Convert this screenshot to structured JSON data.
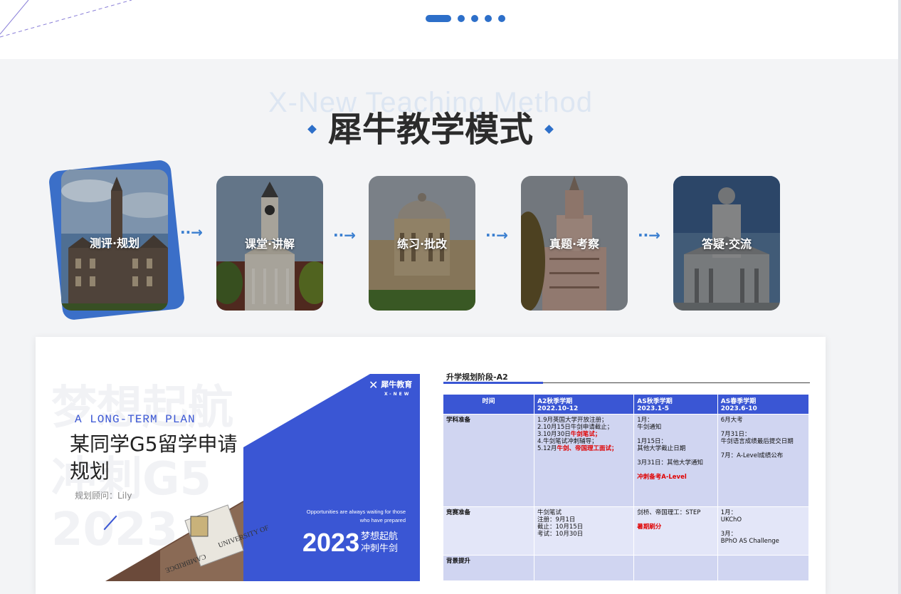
{
  "carousel": {
    "slide_count": 5,
    "active_index": 0
  },
  "section": {
    "title_en": "X-New Teaching Method",
    "title_zh": "犀牛教学模式"
  },
  "steps": [
    {
      "label": "测评·规划",
      "active": true
    },
    {
      "label": "课堂·讲解",
      "active": false
    },
    {
      "label": "练习·批改",
      "active": false
    },
    {
      "label": "真题·考察",
      "active": false
    },
    {
      "label": "答疑·交流",
      "active": false
    }
  ],
  "arrow_glyph": "··→",
  "plan_card": {
    "ghost_top": "梦想起航",
    "ghost_mid": "冲刺G5",
    "ghost_bottom": "2023",
    "subtitle_en": "A LONG-TERM PLAN",
    "title": "某同学G5留学申请规划",
    "advisor": "规划顾问：Lily",
    "logo_name": "犀牛教育",
    "logo_sub": "X-NEW",
    "tagline": "Opportunities are always waiting for those who have prepared",
    "year": "2023",
    "year_caption_1": "梦想起航",
    "year_caption_2": "冲刺牛剑",
    "crest_text_1": "UNIVERSITY OF",
    "crest_text_2": "CAMBRIDGE"
  },
  "plan_table": {
    "title": "升学规划阶段-A2",
    "headers": {
      "time": "时间",
      "col1_a": "A2秋季学期",
      "col1_b": "2022.10-12",
      "col2_a": "AS秋季学期",
      "col2_b": "2023.1-5",
      "col3_a": "AS春季学期",
      "col3_b": "2023.6-10"
    },
    "rows": {
      "r1_head": "学科准备",
      "r1_c1_l1": "1.9月英国大学开放注册；",
      "r1_c1_l2": "2.10月15日牛剑申请截止；",
      "r1_c1_l3a": "3.10月30日",
      "r1_c1_l3b": "牛剑笔试；",
      "r1_c1_l4": "4.牛剑笔试冲刺辅导；",
      "r1_c1_l5a": "5.12月",
      "r1_c1_l5b": "牛剑、帝国理工面试；",
      "r1_c2_l1": "1月：",
      "r1_c2_l2": "牛剑通知",
      "r1_c2_l3": "1月15日：",
      "r1_c2_l4": "其他大学截止日期",
      "r1_c2_l5": "3月31日：其他大学通知",
      "r1_c2_l6": "冲刺备考A-Level",
      "r1_c3_l1": "6月大考",
      "r1_c3_l2": "7月31日：",
      "r1_c3_l3": "牛剑语言成绩最后提交日期",
      "r1_c3_l4": "7月：A-Level成绩公布",
      "r2_head": "竞赛准备",
      "r2_c1_l1": "牛剑笔试",
      "r2_c1_l2": "注册：9月1日",
      "r2_c1_l3": "截止：10月15日",
      "r2_c1_l4": "考试：10月30日",
      "r2_c2_l1": "剑桥、帝国理工：STEP",
      "r2_c2_l2": "暑期刷分",
      "r2_c3_l1": "1月：",
      "r2_c3_l2": "UKChO",
      "r2_c3_l3": "3月：",
      "r2_c3_l4": "BPhO AS Challenge",
      "r3_head": "背景提升"
    }
  },
  "colors": {
    "accent": "#2d6fc9",
    "panel_blue": "#3a56d4",
    "title_dark": "#2b2b2b",
    "page_bg": "#f3f4f6"
  }
}
